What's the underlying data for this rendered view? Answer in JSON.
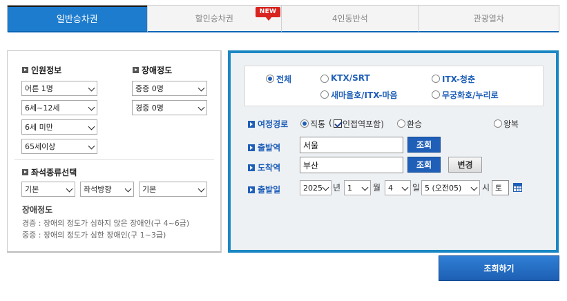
{
  "tabs": [
    {
      "label": "일반승차권"
    },
    {
      "label": "할인승차권",
      "badge": "NEW"
    },
    {
      "label": "4인동반석"
    },
    {
      "label": "관광열차"
    }
  ],
  "passenger": {
    "title": "인원정보",
    "selects": [
      "어른 1명",
      "6세~12세",
      "6세 미만",
      "65세이상"
    ]
  },
  "disability": {
    "title": "장애정도",
    "selects": [
      "중증 0명",
      "경증 0명"
    ]
  },
  "seat": {
    "title": "좌석종류선택",
    "selects": [
      "기본",
      "좌석방향",
      "기본"
    ]
  },
  "disability_desc": {
    "title": "장애정도",
    "lines": [
      "경증 : 장애의 정도가 심하지 않은 장애인(구 4~6급)",
      "중증 : 장애의 정도가 심한 장애인(구 1~3급)"
    ]
  },
  "train_types": [
    {
      "label": "전체",
      "selected": true
    },
    {
      "label": "KTX/SRT",
      "selected": false
    },
    {
      "label": "ITX-청춘",
      "selected": false
    },
    {
      "label": "새마을호/ITX-마음",
      "selected": false
    },
    {
      "label": "무궁화호/누리로",
      "selected": false
    }
  ],
  "route": {
    "label": "여정경로",
    "direct": "직통",
    "adjacent_prefix": "(",
    "adjacent": "인접역포함)",
    "transfer": "환승",
    "round_trip": "왕복"
  },
  "departure": {
    "label": "출발역",
    "value": "서울",
    "button": "조회"
  },
  "arrival": {
    "label": "도착역",
    "value": "부산",
    "button": "조회",
    "swap_button": "변경"
  },
  "date": {
    "label": "출발일",
    "year": "2025",
    "year_unit": "년",
    "month": "1",
    "month_unit": "월",
    "day": "4",
    "day_unit": "일",
    "hour": "5 (오전05)",
    "hour_unit": "시",
    "weekday": "토"
  },
  "submit_label": "조회하기",
  "colors": {
    "accent": "#1d7ccd",
    "panel_border": "#1a87c3",
    "badge": "#d8231e"
  }
}
